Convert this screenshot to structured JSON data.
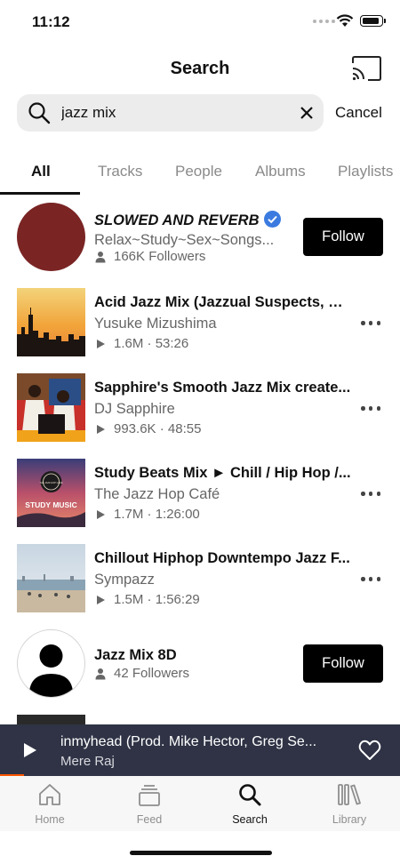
{
  "status_bar": {
    "time": "11:12"
  },
  "header": {
    "title": "Search",
    "cast_icon": "cast-icon"
  },
  "search": {
    "value": "jazz mix",
    "placeholder": "Search",
    "cancel_label": "Cancel"
  },
  "tabs": [
    {
      "label": "All",
      "active": true
    },
    {
      "label": "Tracks",
      "active": false
    },
    {
      "label": "People",
      "active": false
    },
    {
      "label": "Albums",
      "active": false
    },
    {
      "label": "Playlists",
      "active": false
    }
  ],
  "results": [
    {
      "kind": "user",
      "title": "SLOWED AND REVERB",
      "verified": true,
      "subtitle": "Relax~Study~Sex~Songs...",
      "meta": "166K Followers",
      "action_label": "Follow",
      "avatar_color": "#7a2424"
    },
    {
      "kind": "track",
      "title": "Acid Jazz Mix (Jazzual Suspects, Gr...",
      "subtitle": "Yusuke Mizushima",
      "plays": "1.6M",
      "duration": "53:26"
    },
    {
      "kind": "track",
      "title": "Sapphire's Smooth Jazz Mix create...",
      "subtitle": "DJ Sapphire",
      "plays": "993.6K",
      "duration": "48:55"
    },
    {
      "kind": "track",
      "title": "Study Beats Mix ► Chill / Hip Hop /...",
      "subtitle": "The Jazz Hop Café",
      "plays": "1.7M",
      "duration": "1:26:00",
      "artwork_text": "STUDY MUSIC",
      "artwork_badge": "THE JAZZ HOP CAFÉ"
    },
    {
      "kind": "track",
      "title": "Chillout Hiphop Downtempo Jazz F...",
      "subtitle": "Sympazz",
      "plays": "1.5M",
      "duration": "1:56:29"
    },
    {
      "kind": "user",
      "title": "Jazz Mix 8D",
      "meta": "42 Followers",
      "action_label": "Follow"
    }
  ],
  "mini_player": {
    "title": "inmyhead (Prod. Mike Hector, Greg Se...",
    "artist": "Mere Raj",
    "progress": 0.06
  },
  "bottom_nav": [
    {
      "label": "Home",
      "icon": "home-icon",
      "active": false
    },
    {
      "label": "Feed",
      "icon": "feed-icon",
      "active": false
    },
    {
      "label": "Search",
      "icon": "search-icon",
      "active": true
    },
    {
      "label": "Library",
      "icon": "library-icon",
      "active": false
    }
  ],
  "colors": {
    "accent": "#ff5500",
    "player_bg": "#2f3345",
    "verified": "#3b7be0"
  }
}
